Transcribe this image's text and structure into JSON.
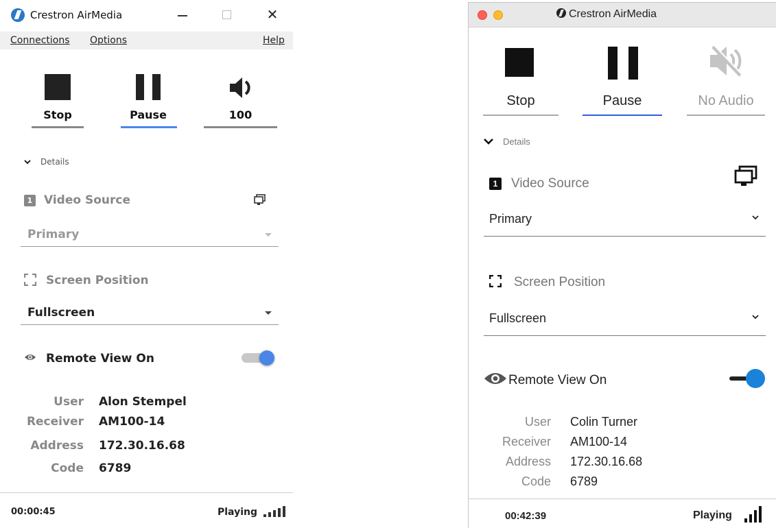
{
  "windows_app": {
    "title": "Crestron AirMedia",
    "menu": {
      "connections": "Connections",
      "options": "Options",
      "help": "Help"
    },
    "controls": {
      "stop_label": "Stop",
      "pause_label": "Pause",
      "volume_label": "100"
    },
    "details_label": "Details",
    "video_source": {
      "badge": "1",
      "label": "Video Source",
      "selected": "Primary"
    },
    "screen_position": {
      "label": "Screen Position",
      "selected": "Fullscreen"
    },
    "remote_view": {
      "label": "Remote View On",
      "enabled": true
    },
    "info": [
      {
        "key": "User",
        "value": "Alon Stempel"
      },
      {
        "key": "Receiver",
        "value": "AM100-14"
      },
      {
        "key": "Address",
        "value": "172.30.16.68"
      },
      {
        "key": "Code",
        "value": "6789"
      }
    ],
    "footer": {
      "elapsed": "00:00:45",
      "status": "Playing"
    },
    "colors": {
      "accent": "#4a86e8",
      "muted_text": "#888888"
    }
  },
  "mac_app": {
    "title": "Crestron AirMedia",
    "controls": {
      "stop_label": "Stop",
      "pause_label": "Pause",
      "audio_label": "No Audio"
    },
    "details_label": "Details",
    "video_source": {
      "badge": "1",
      "label": "Video Source",
      "selected": "Primary"
    },
    "screen_position": {
      "label": "Screen Position",
      "selected": "Fullscreen"
    },
    "remote_view": {
      "label": "Remote View On",
      "enabled": true
    },
    "info": [
      {
        "key": "User",
        "value": "Colin Turner"
      },
      {
        "key": "Receiver",
        "value": "AM100-14"
      },
      {
        "key": "Address",
        "value": "172.30.16.68"
      },
      {
        "key": "Code",
        "value": "6789"
      }
    ],
    "footer": {
      "elapsed": "00:42:39",
      "status": "Playing"
    },
    "colors": {
      "accent": "#2b5fd9",
      "toggle": "#1a82d8",
      "close": "#ff5f57",
      "minimize": "#febc2e"
    }
  }
}
